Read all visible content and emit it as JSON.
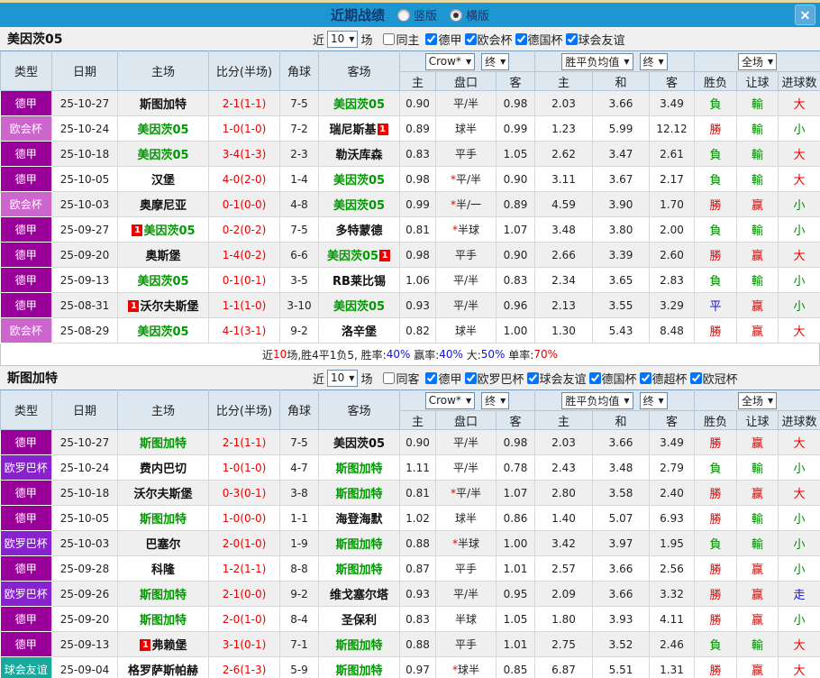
{
  "titlebar": {
    "title": "近期战绩",
    "option_vertical": "竖版",
    "option_horizontal": "横版",
    "selected_option": "横版",
    "close_glyph": "✕"
  },
  "colors": {
    "titlebar_bg": "#1e96d2",
    "red": "#e60000",
    "green": "#008800",
    "blue": "#1414cc",
    "team_green": "#009900",
    "league": {
      "德甲": "#990099",
      "欧会杯": "#cc66cc",
      "欧罗巴杯": "#8822cc",
      "球会友谊": "#18a89c"
    }
  },
  "card_text": "1",
  "table_header": {
    "columns": [
      "类型",
      "日期",
      "主场",
      "比分(半场)",
      "角球",
      "客场"
    ],
    "odds_source": "Crow*",
    "odds_final": "终",
    "mean_label": "胜平负均值",
    "mean_final": "终",
    "scope_label": "全场",
    "sub_columns": [
      "主",
      "盘口",
      "客",
      "主",
      "和",
      "客",
      "胜负",
      "让球",
      "进球数"
    ]
  },
  "sections": [
    {
      "team": "美因茨05",
      "filter": {
        "near": "近",
        "count": "10",
        "unit": "场",
        "same": "同主",
        "same_checked": false,
        "leagues": [
          "德甲",
          "欧会杯",
          "德国杯",
          "球会友谊"
        ]
      },
      "rows": [
        {
          "lg": "德甲",
          "date": "25-10-27",
          "h": {
            "n": "斯图加特"
          },
          "s": "2-1",
          "hf": "(1-1)",
          "cn": "7-5",
          "a": {
            "n": "美因茨05",
            "g": 1
          },
          "o": [
            "0.90",
            "平/半",
            "0.98"
          ],
          "st": 0,
          "m": [
            "2.03",
            "3.66",
            "3.49"
          ],
          "r": [
            "負",
            "g"
          ],
          "hr": [
            "輸",
            "g"
          ],
          "gl": [
            "大",
            "r"
          ]
        },
        {
          "lg": "欧会杯",
          "date": "25-10-24",
          "h": {
            "n": "美因茨05",
            "g": 1
          },
          "s": "1-0",
          "hf": "(1-0)",
          "cn": "7-2",
          "a": {
            "n": "瑞尼斯基",
            "b": 2
          },
          "o": [
            "0.89",
            "球半",
            "0.99"
          ],
          "st": 0,
          "m": [
            "1.23",
            "5.99",
            "12.12"
          ],
          "r": [
            "勝",
            "r"
          ],
          "hr": [
            "輸",
            "g"
          ],
          "gl": [
            "小",
            "g"
          ]
        },
        {
          "lg": "德甲",
          "date": "25-10-18",
          "h": {
            "n": "美因茨05",
            "g": 1
          },
          "s": "3-4",
          "hf": "(1-3)",
          "cn": "2-3",
          "a": {
            "n": "勒沃库森"
          },
          "o": [
            "0.83",
            "平手",
            "1.05"
          ],
          "st": 0,
          "m": [
            "2.62",
            "3.47",
            "2.61"
          ],
          "r": [
            "負",
            "g"
          ],
          "hr": [
            "輸",
            "g"
          ],
          "gl": [
            "大",
            "r"
          ]
        },
        {
          "lg": "德甲",
          "date": "25-10-05",
          "h": {
            "n": "汉堡"
          },
          "s": "4-0",
          "hf": "(2-0)",
          "cn": "1-4",
          "a": {
            "n": "美因茨05",
            "g": 1
          },
          "o": [
            "0.98",
            "平/半",
            "0.90"
          ],
          "st": 1,
          "m": [
            "3.11",
            "3.67",
            "2.17"
          ],
          "r": [
            "負",
            "g"
          ],
          "hr": [
            "輸",
            "g"
          ],
          "gl": [
            "大",
            "r"
          ]
        },
        {
          "lg": "欧会杯",
          "date": "25-10-03",
          "h": {
            "n": "奥摩尼亚"
          },
          "s": "0-1",
          "hf": "(0-0)",
          "cn": "4-8",
          "a": {
            "n": "美因茨05",
            "g": 1
          },
          "o": [
            "0.99",
            "半/一",
            "0.89"
          ],
          "st": 1,
          "m": [
            "4.59",
            "3.90",
            "1.70"
          ],
          "r": [
            "勝",
            "r"
          ],
          "hr": [
            "赢",
            "r"
          ],
          "gl": [
            "小",
            "g"
          ]
        },
        {
          "lg": "德甲",
          "date": "25-09-27",
          "h": {
            "n": "美因茨05",
            "g": 1,
            "b": 1
          },
          "s": "0-2",
          "hf": "(0-2)",
          "cn": "7-5",
          "a": {
            "n": "多特蒙德"
          },
          "o": [
            "0.81",
            "半球",
            "1.07"
          ],
          "st": 1,
          "m": [
            "3.48",
            "3.80",
            "2.00"
          ],
          "r": [
            "負",
            "g"
          ],
          "hr": [
            "輸",
            "g"
          ],
          "gl": [
            "小",
            "g"
          ]
        },
        {
          "lg": "德甲",
          "date": "25-09-20",
          "h": {
            "n": "奥斯堡"
          },
          "s": "1-4",
          "hf": "(0-2)",
          "cn": "6-6",
          "a": {
            "n": "美因茨05",
            "g": 1,
            "b": 2
          },
          "o": [
            "0.98",
            "平手",
            "0.90"
          ],
          "st": 0,
          "m": [
            "2.66",
            "3.39",
            "2.60"
          ],
          "r": [
            "勝",
            "r"
          ],
          "hr": [
            "赢",
            "r"
          ],
          "gl": [
            "大",
            "r"
          ]
        },
        {
          "lg": "德甲",
          "date": "25-09-13",
          "h": {
            "n": "美因茨05",
            "g": 1
          },
          "s": "0-1",
          "hf": "(0-1)",
          "cn": "3-5",
          "a": {
            "n": "RB莱比锡"
          },
          "o": [
            "1.06",
            "平/半",
            "0.83"
          ],
          "st": 0,
          "m": [
            "2.34",
            "3.65",
            "2.83"
          ],
          "r": [
            "負",
            "g"
          ],
          "hr": [
            "輸",
            "g"
          ],
          "gl": [
            "小",
            "g"
          ]
        },
        {
          "lg": "德甲",
          "date": "25-08-31",
          "h": {
            "n": "沃尔夫斯堡",
            "b": 1
          },
          "s": "1-1",
          "hf": "(1-0)",
          "cn": "3-10",
          "a": {
            "n": "美因茨05",
            "g": 1
          },
          "o": [
            "0.93",
            "平/半",
            "0.96"
          ],
          "st": 0,
          "m": [
            "2.13",
            "3.55",
            "3.29"
          ],
          "r": [
            "平",
            "b"
          ],
          "hr": [
            "赢",
            "r"
          ],
          "gl": [
            "小",
            "g"
          ]
        },
        {
          "lg": "欧会杯",
          "date": "25-08-29",
          "h": {
            "n": "美因茨05",
            "g": 1
          },
          "s": "4-1",
          "hf": "(3-1)",
          "cn": "9-2",
          "a": {
            "n": "洛辛堡"
          },
          "o": [
            "0.82",
            "球半",
            "1.00"
          ],
          "st": 0,
          "m": [
            "1.30",
            "5.43",
            "8.48"
          ],
          "r": [
            "勝",
            "r"
          ],
          "hr": [
            "赢",
            "r"
          ],
          "gl": [
            "大",
            "r"
          ]
        }
      ],
      "summary": [
        [
          "近",
          "k"
        ],
        [
          "10",
          "r"
        ],
        [
          "场,胜4平1负5, 胜率:",
          "k"
        ],
        [
          "40%",
          "b"
        ],
        [
          " 赢率:",
          "k"
        ],
        [
          "40%",
          "b"
        ],
        [
          " 大:",
          "k"
        ],
        [
          "50%",
          "b"
        ],
        [
          " 单率:",
          "k"
        ],
        [
          "70%",
          "r"
        ]
      ]
    },
    {
      "team": "斯图加特",
      "filter": {
        "near": "近",
        "count": "10",
        "unit": "场",
        "same": "同客",
        "same_checked": false,
        "leagues": [
          "德甲",
          "欧罗巴杯",
          "球会友谊",
          "德国杯",
          "德超杯",
          "欧冠杯"
        ]
      },
      "rows": [
        {
          "lg": "德甲",
          "date": "25-10-27",
          "h": {
            "n": "斯图加特",
            "g": 1
          },
          "s": "2-1",
          "hf": "(1-1)",
          "cn": "7-5",
          "a": {
            "n": "美因茨05"
          },
          "o": [
            "0.90",
            "平/半",
            "0.98"
          ],
          "st": 0,
          "m": [
            "2.03",
            "3.66",
            "3.49"
          ],
          "r": [
            "勝",
            "r"
          ],
          "hr": [
            "赢",
            "r"
          ],
          "gl": [
            "大",
            "r"
          ]
        },
        {
          "lg": "欧罗巴杯",
          "date": "25-10-24",
          "h": {
            "n": "费内巴切"
          },
          "s": "1-0",
          "hf": "(1-0)",
          "cn": "4-7",
          "a": {
            "n": "斯图加特",
            "g": 1
          },
          "o": [
            "1.11",
            "平/半",
            "0.78"
          ],
          "st": 0,
          "m": [
            "2.43",
            "3.48",
            "2.79"
          ],
          "r": [
            "負",
            "g"
          ],
          "hr": [
            "輸",
            "g"
          ],
          "gl": [
            "小",
            "g"
          ]
        },
        {
          "lg": "德甲",
          "date": "25-10-18",
          "h": {
            "n": "沃尔夫斯堡"
          },
          "s": "0-3",
          "hf": "(0-1)",
          "cn": "3-8",
          "a": {
            "n": "斯图加特",
            "g": 1
          },
          "o": [
            "0.81",
            "平/半",
            "1.07"
          ],
          "st": 1,
          "m": [
            "2.80",
            "3.58",
            "2.40"
          ],
          "r": [
            "勝",
            "r"
          ],
          "hr": [
            "赢",
            "r"
          ],
          "gl": [
            "大",
            "r"
          ]
        },
        {
          "lg": "德甲",
          "date": "25-10-05",
          "h": {
            "n": "斯图加特",
            "g": 1
          },
          "s": "1-0",
          "hf": "(0-0)",
          "cn": "1-1",
          "a": {
            "n": "海登海默"
          },
          "o": [
            "1.02",
            "球半",
            "0.86"
          ],
          "st": 0,
          "m": [
            "1.40",
            "5.07",
            "6.93"
          ],
          "r": [
            "勝",
            "r"
          ],
          "hr": [
            "輸",
            "g"
          ],
          "gl": [
            "小",
            "g"
          ]
        },
        {
          "lg": "欧罗巴杯",
          "date": "25-10-03",
          "h": {
            "n": "巴塞尔"
          },
          "s": "2-0",
          "hf": "(1-0)",
          "cn": "1-9",
          "a": {
            "n": "斯图加特",
            "g": 1
          },
          "o": [
            "0.88",
            "半球",
            "1.00"
          ],
          "st": 1,
          "m": [
            "3.42",
            "3.97",
            "1.95"
          ],
          "r": [
            "負",
            "g"
          ],
          "hr": [
            "輸",
            "g"
          ],
          "gl": [
            "小",
            "g"
          ]
        },
        {
          "lg": "德甲",
          "date": "25-09-28",
          "h": {
            "n": "科隆"
          },
          "s": "1-2",
          "hf": "(1-1)",
          "cn": "8-8",
          "a": {
            "n": "斯图加特",
            "g": 1
          },
          "o": [
            "0.87",
            "平手",
            "1.01"
          ],
          "st": 0,
          "m": [
            "2.57",
            "3.66",
            "2.56"
          ],
          "r": [
            "勝",
            "r"
          ],
          "hr": [
            "赢",
            "r"
          ],
          "gl": [
            "小",
            "g"
          ]
        },
        {
          "lg": "欧罗巴杯",
          "date": "25-09-26",
          "h": {
            "n": "斯图加特",
            "g": 1
          },
          "s": "2-1",
          "hf": "(0-0)",
          "cn": "9-2",
          "a": {
            "n": "维戈塞尔塔"
          },
          "o": [
            "0.93",
            "平/半",
            "0.95"
          ],
          "st": 0,
          "m": [
            "2.09",
            "3.66",
            "3.32"
          ],
          "r": [
            "勝",
            "r"
          ],
          "hr": [
            "赢",
            "r"
          ],
          "gl": [
            "走",
            "b"
          ]
        },
        {
          "lg": "德甲",
          "date": "25-09-20",
          "h": {
            "n": "斯图加特",
            "g": 1
          },
          "s": "2-0",
          "hf": "(1-0)",
          "cn": "8-4",
          "a": {
            "n": "圣保利"
          },
          "o": [
            "0.83",
            "半球",
            "1.05"
          ],
          "st": 0,
          "m": [
            "1.80",
            "3.93",
            "4.11"
          ],
          "r": [
            "勝",
            "r"
          ],
          "hr": [
            "赢",
            "r"
          ],
          "gl": [
            "小",
            "g"
          ]
        },
        {
          "lg": "德甲",
          "date": "25-09-13",
          "h": {
            "n": "弗赖堡",
            "b": 1
          },
          "s": "3-1",
          "hf": "(0-1)",
          "cn": "7-1",
          "a": {
            "n": "斯图加特",
            "g": 1
          },
          "o": [
            "0.88",
            "平手",
            "1.01"
          ],
          "st": 0,
          "m": [
            "2.75",
            "3.52",
            "2.46"
          ],
          "r": [
            "負",
            "g"
          ],
          "hr": [
            "輸",
            "g"
          ],
          "gl": [
            "大",
            "r"
          ]
        },
        {
          "lg": "球会友谊",
          "date": "25-09-04",
          "h": {
            "n": "格罗萨斯帕赫"
          },
          "s": "2-6",
          "hf": "(1-3)",
          "cn": "5-9",
          "a": {
            "n": "斯图加特",
            "g": 1
          },
          "o": [
            "0.97",
            "球半",
            "0.85"
          ],
          "st": 1,
          "m": [
            "6.87",
            "5.51",
            "1.31"
          ],
          "r": [
            "勝",
            "r"
          ],
          "hr": [
            "赢",
            "r"
          ],
          "gl": [
            "大",
            "r"
          ]
        }
      ],
      "summary": null
    }
  ]
}
